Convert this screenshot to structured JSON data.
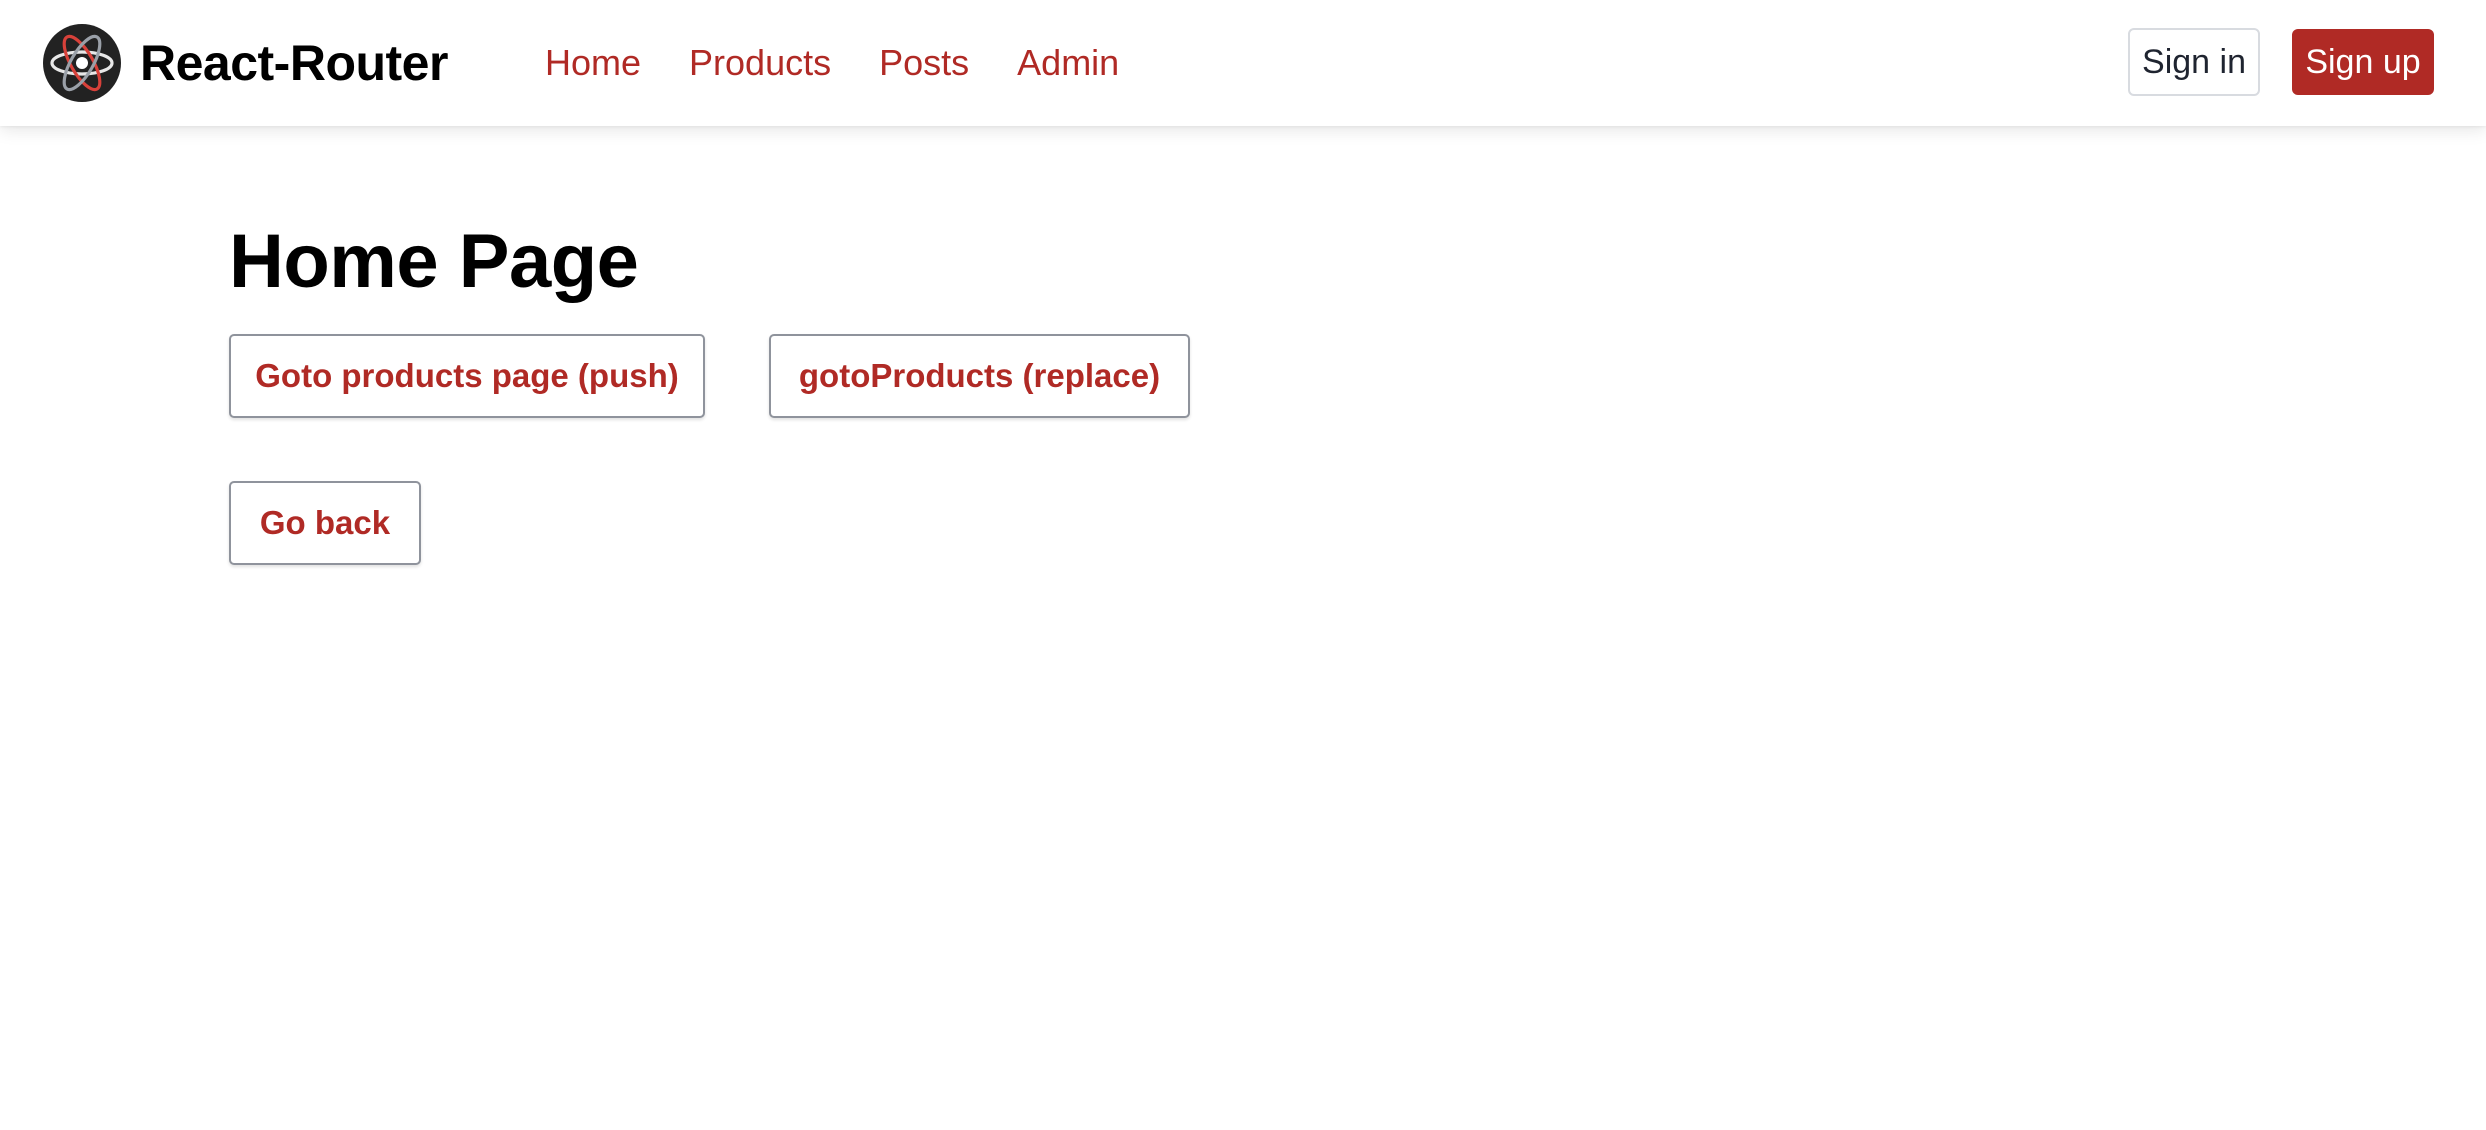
{
  "colors": {
    "accent": "#b02a25",
    "text_dark": "#000000",
    "border": "#8f939c",
    "background": "#ffffff"
  },
  "header": {
    "brand": {
      "title": "React-Router",
      "logo_icon": "react-atom-icon"
    },
    "nav": {
      "items": [
        {
          "label": "Home"
        },
        {
          "label": "Products"
        },
        {
          "label": "Posts"
        },
        {
          "label": "Admin"
        }
      ]
    },
    "auth": {
      "signin_label": "Sign in",
      "signup_label": "Sign up"
    }
  },
  "main": {
    "title": "Home Page",
    "buttons": {
      "push_label": "Goto products page (push)",
      "replace_label": "gotoProducts (replace)",
      "back_label": "Go back"
    }
  }
}
